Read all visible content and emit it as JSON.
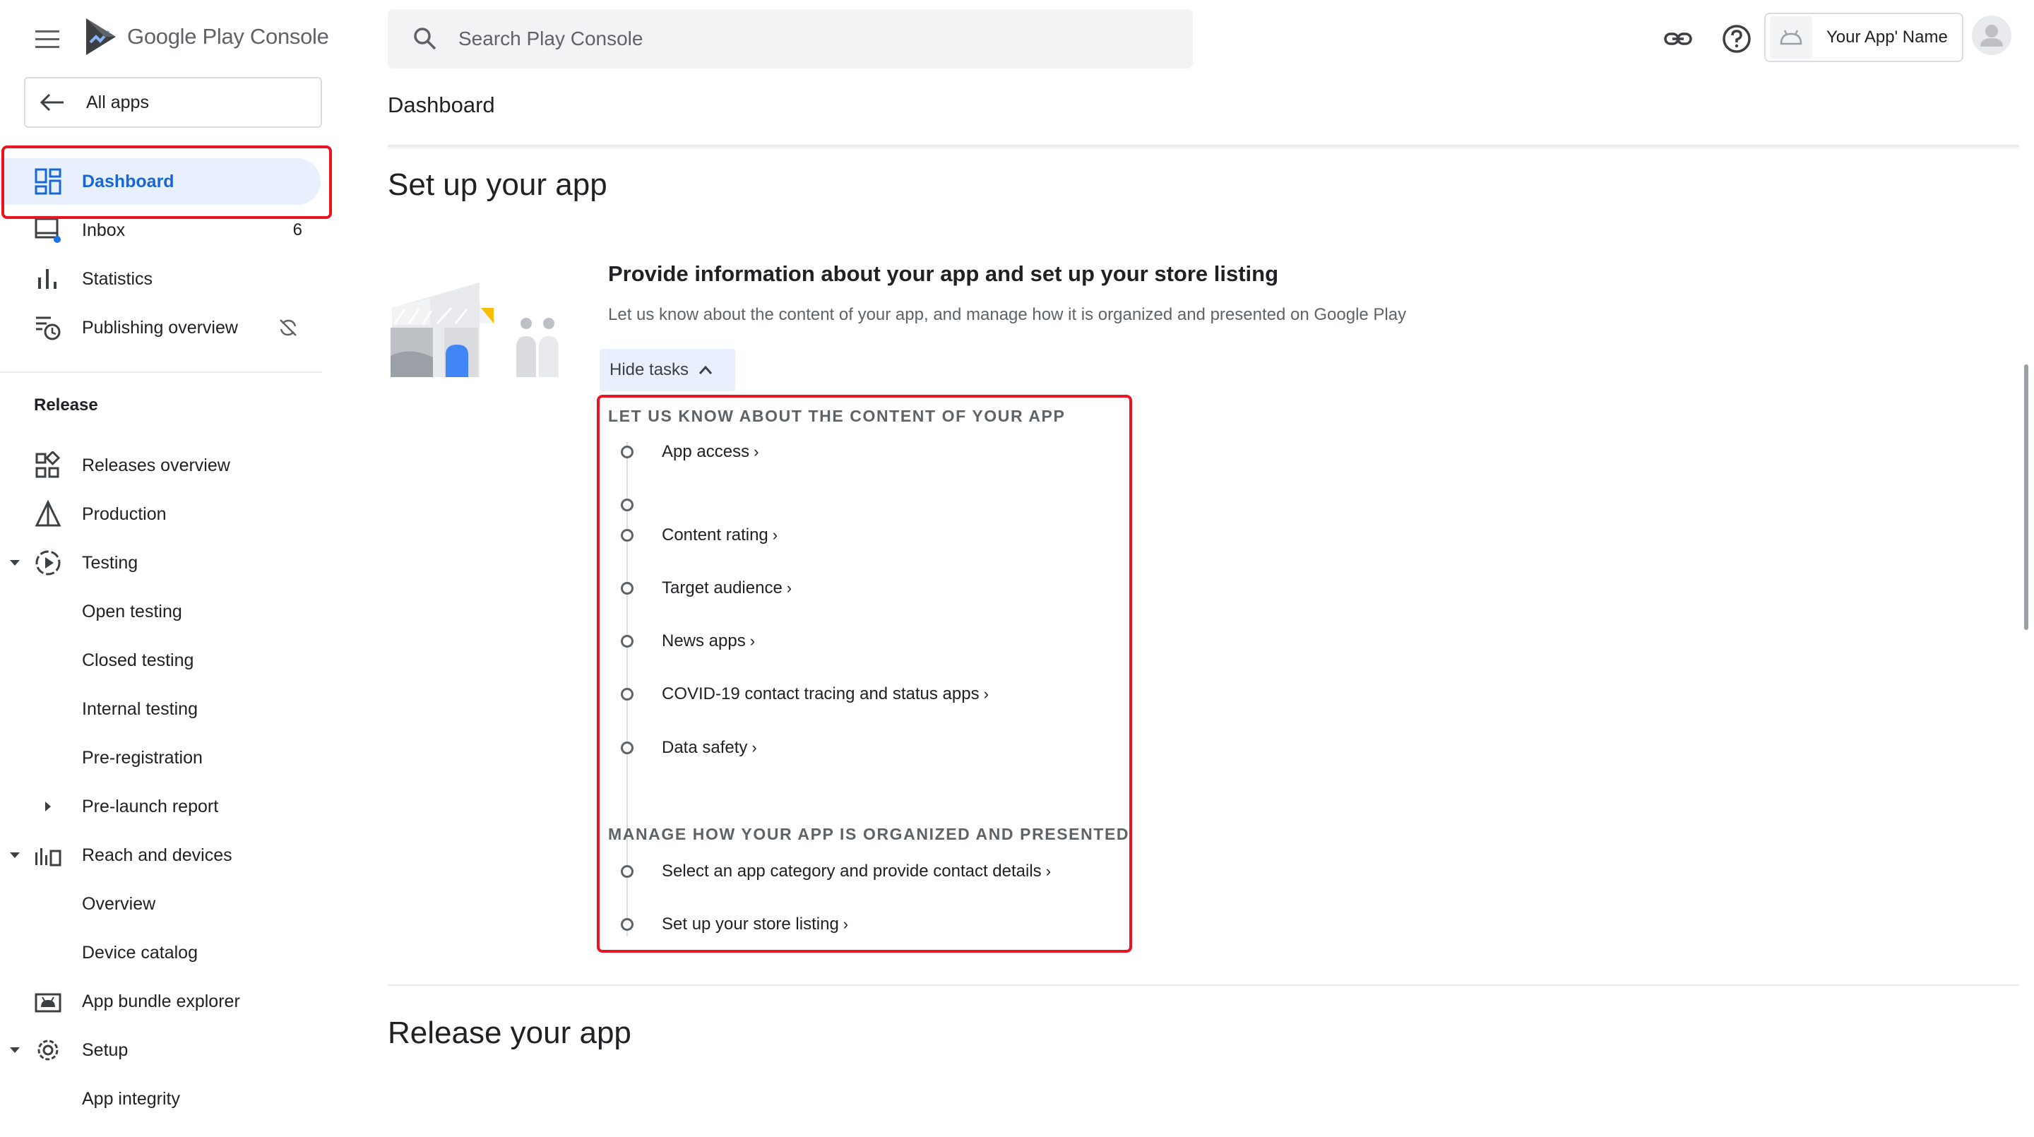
{
  "brand": {
    "google": "Google Play",
    "console": "Console"
  },
  "search": {
    "placeholder": "Search Play Console"
  },
  "header": {
    "app_name": "Your App' Name"
  },
  "sidebar": {
    "back_label": "All apps",
    "items": [
      {
        "label": "Dashboard"
      },
      {
        "label": "Inbox",
        "count": "6"
      },
      {
        "label": "Statistics"
      },
      {
        "label": "Publishing overview"
      }
    ],
    "release_section": "Release",
    "release_items": [
      {
        "label": "Releases overview"
      },
      {
        "label": "Production"
      },
      {
        "label": "Testing"
      },
      {
        "label": "Open testing"
      },
      {
        "label": "Closed testing"
      },
      {
        "label": "Internal testing"
      },
      {
        "label": "Pre-registration"
      },
      {
        "label": "Pre-launch report"
      },
      {
        "label": "Reach and devices"
      },
      {
        "label": "Overview"
      },
      {
        "label": "Device catalog"
      },
      {
        "label": "App bundle explorer"
      },
      {
        "label": "Setup"
      },
      {
        "label": "App integrity"
      }
    ]
  },
  "main": {
    "page_title": "Dashboard",
    "setup_heading": "Set up your app",
    "card": {
      "title": "Provide information about your app and set up your store listing",
      "description": "Let us know about the content of your app, and manage how it is organized and presented on Google Play",
      "toggle_label": "Hide tasks"
    },
    "task_groups": [
      {
        "title": "LET US KNOW ABOUT THE CONTENT OF YOUR APP",
        "tasks": [
          "App access",
          "",
          "Content rating",
          "Target audience",
          "News apps",
          "COVID-19 contact tracing and status apps",
          "Data safety"
        ]
      },
      {
        "title": "MANAGE HOW YOUR APP IS ORGANIZED AND PRESENTED",
        "tasks": [
          "Select an app category and provide contact details",
          "Set up your store listing"
        ]
      }
    ],
    "release_heading": "Release your app"
  },
  "colors": {
    "accent": "#1967d2",
    "active_bg": "#e8f0fe",
    "highlight": "#e8141f",
    "play_blue": "#4285f4",
    "play_yellow": "#fbbc04"
  }
}
